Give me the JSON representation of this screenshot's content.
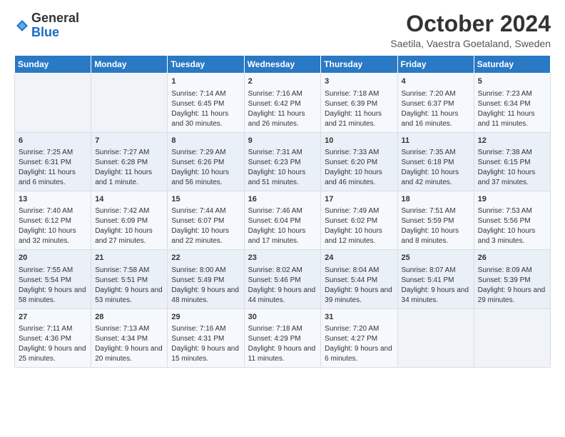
{
  "header": {
    "logo_line1": "General",
    "logo_line2": "Blue",
    "month_title": "October 2024",
    "location": "Saetila, Vaestra Goetaland, Sweden"
  },
  "weekdays": [
    "Sunday",
    "Monday",
    "Tuesday",
    "Wednesday",
    "Thursday",
    "Friday",
    "Saturday"
  ],
  "weeks": [
    [
      {
        "day": "",
        "data": ""
      },
      {
        "day": "",
        "data": ""
      },
      {
        "day": "1",
        "data": "Sunrise: 7:14 AM\nSunset: 6:45 PM\nDaylight: 11 hours and 30 minutes."
      },
      {
        "day": "2",
        "data": "Sunrise: 7:16 AM\nSunset: 6:42 PM\nDaylight: 11 hours and 26 minutes."
      },
      {
        "day": "3",
        "data": "Sunrise: 7:18 AM\nSunset: 6:39 PM\nDaylight: 11 hours and 21 minutes."
      },
      {
        "day": "4",
        "data": "Sunrise: 7:20 AM\nSunset: 6:37 PM\nDaylight: 11 hours and 16 minutes."
      },
      {
        "day": "5",
        "data": "Sunrise: 7:23 AM\nSunset: 6:34 PM\nDaylight: 11 hours and 11 minutes."
      }
    ],
    [
      {
        "day": "6",
        "data": "Sunrise: 7:25 AM\nSunset: 6:31 PM\nDaylight: 11 hours and 6 minutes."
      },
      {
        "day": "7",
        "data": "Sunrise: 7:27 AM\nSunset: 6:28 PM\nDaylight: 11 hours and 1 minute."
      },
      {
        "day": "8",
        "data": "Sunrise: 7:29 AM\nSunset: 6:26 PM\nDaylight: 10 hours and 56 minutes."
      },
      {
        "day": "9",
        "data": "Sunrise: 7:31 AM\nSunset: 6:23 PM\nDaylight: 10 hours and 51 minutes."
      },
      {
        "day": "10",
        "data": "Sunrise: 7:33 AM\nSunset: 6:20 PM\nDaylight: 10 hours and 46 minutes."
      },
      {
        "day": "11",
        "data": "Sunrise: 7:35 AM\nSunset: 6:18 PM\nDaylight: 10 hours and 42 minutes."
      },
      {
        "day": "12",
        "data": "Sunrise: 7:38 AM\nSunset: 6:15 PM\nDaylight: 10 hours and 37 minutes."
      }
    ],
    [
      {
        "day": "13",
        "data": "Sunrise: 7:40 AM\nSunset: 6:12 PM\nDaylight: 10 hours and 32 minutes."
      },
      {
        "day": "14",
        "data": "Sunrise: 7:42 AM\nSunset: 6:09 PM\nDaylight: 10 hours and 27 minutes."
      },
      {
        "day": "15",
        "data": "Sunrise: 7:44 AM\nSunset: 6:07 PM\nDaylight: 10 hours and 22 minutes."
      },
      {
        "day": "16",
        "data": "Sunrise: 7:46 AM\nSunset: 6:04 PM\nDaylight: 10 hours and 17 minutes."
      },
      {
        "day": "17",
        "data": "Sunrise: 7:49 AM\nSunset: 6:02 PM\nDaylight: 10 hours and 12 minutes."
      },
      {
        "day": "18",
        "data": "Sunrise: 7:51 AM\nSunset: 5:59 PM\nDaylight: 10 hours and 8 minutes."
      },
      {
        "day": "19",
        "data": "Sunrise: 7:53 AM\nSunset: 5:56 PM\nDaylight: 10 hours and 3 minutes."
      }
    ],
    [
      {
        "day": "20",
        "data": "Sunrise: 7:55 AM\nSunset: 5:54 PM\nDaylight: 9 hours and 58 minutes."
      },
      {
        "day": "21",
        "data": "Sunrise: 7:58 AM\nSunset: 5:51 PM\nDaylight: 9 hours and 53 minutes."
      },
      {
        "day": "22",
        "data": "Sunrise: 8:00 AM\nSunset: 5:49 PM\nDaylight: 9 hours and 48 minutes."
      },
      {
        "day": "23",
        "data": "Sunrise: 8:02 AM\nSunset: 5:46 PM\nDaylight: 9 hours and 44 minutes."
      },
      {
        "day": "24",
        "data": "Sunrise: 8:04 AM\nSunset: 5:44 PM\nDaylight: 9 hours and 39 minutes."
      },
      {
        "day": "25",
        "data": "Sunrise: 8:07 AM\nSunset: 5:41 PM\nDaylight: 9 hours and 34 minutes."
      },
      {
        "day": "26",
        "data": "Sunrise: 8:09 AM\nSunset: 5:39 PM\nDaylight: 9 hours and 29 minutes."
      }
    ],
    [
      {
        "day": "27",
        "data": "Sunrise: 7:11 AM\nSunset: 4:36 PM\nDaylight: 9 hours and 25 minutes."
      },
      {
        "day": "28",
        "data": "Sunrise: 7:13 AM\nSunset: 4:34 PM\nDaylight: 9 hours and 20 minutes."
      },
      {
        "day": "29",
        "data": "Sunrise: 7:16 AM\nSunset: 4:31 PM\nDaylight: 9 hours and 15 minutes."
      },
      {
        "day": "30",
        "data": "Sunrise: 7:18 AM\nSunset: 4:29 PM\nDaylight: 9 hours and 11 minutes."
      },
      {
        "day": "31",
        "data": "Sunrise: 7:20 AM\nSunset: 4:27 PM\nDaylight: 9 hours and 6 minutes."
      },
      {
        "day": "",
        "data": ""
      },
      {
        "day": "",
        "data": ""
      }
    ]
  ]
}
